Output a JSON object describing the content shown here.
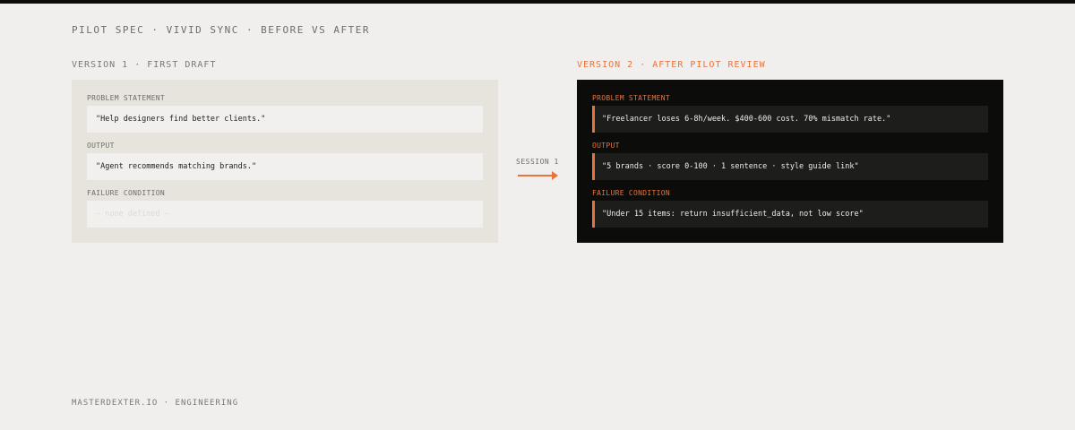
{
  "header": {
    "title": "PILOT SPEC · VIVID SYNC · BEFORE VS AFTER"
  },
  "versions": [
    {
      "label": "VERSION 1 · FIRST DRAFT",
      "fields": [
        {
          "label": "PROBLEM STATEMENT",
          "value": "\"Help designers find better clients.\""
        },
        {
          "label": "OUTPUT",
          "value": "\"Agent recommends matching brands.\""
        },
        {
          "label": "FAILURE CONDITION",
          "value": "— none defined —"
        }
      ]
    },
    {
      "label": "VERSION 2 · AFTER PILOT REVIEW",
      "fields": [
        {
          "label": "PROBLEM STATEMENT",
          "value": "\"Freelancer loses 6-8h/week. $400-600 cost. 70% mismatch rate.\""
        },
        {
          "label": "OUTPUT",
          "value": "\"5 brands · score 0-100 · 1 sentence · style guide link\""
        },
        {
          "label": "FAILURE CONDITION",
          "value": "\"Under 15 items: return insufficient_data, not low score\""
        }
      ]
    }
  ],
  "connector": {
    "label": "SESSION 1"
  },
  "footer": {
    "text": "MASTERDEXTER.IO · ENGINEERING"
  },
  "colors": {
    "accent": "#e8743b",
    "page_background": "#f0efed",
    "dark_panel": "#0c0c0b",
    "light_panel": "#e6e4dd"
  }
}
